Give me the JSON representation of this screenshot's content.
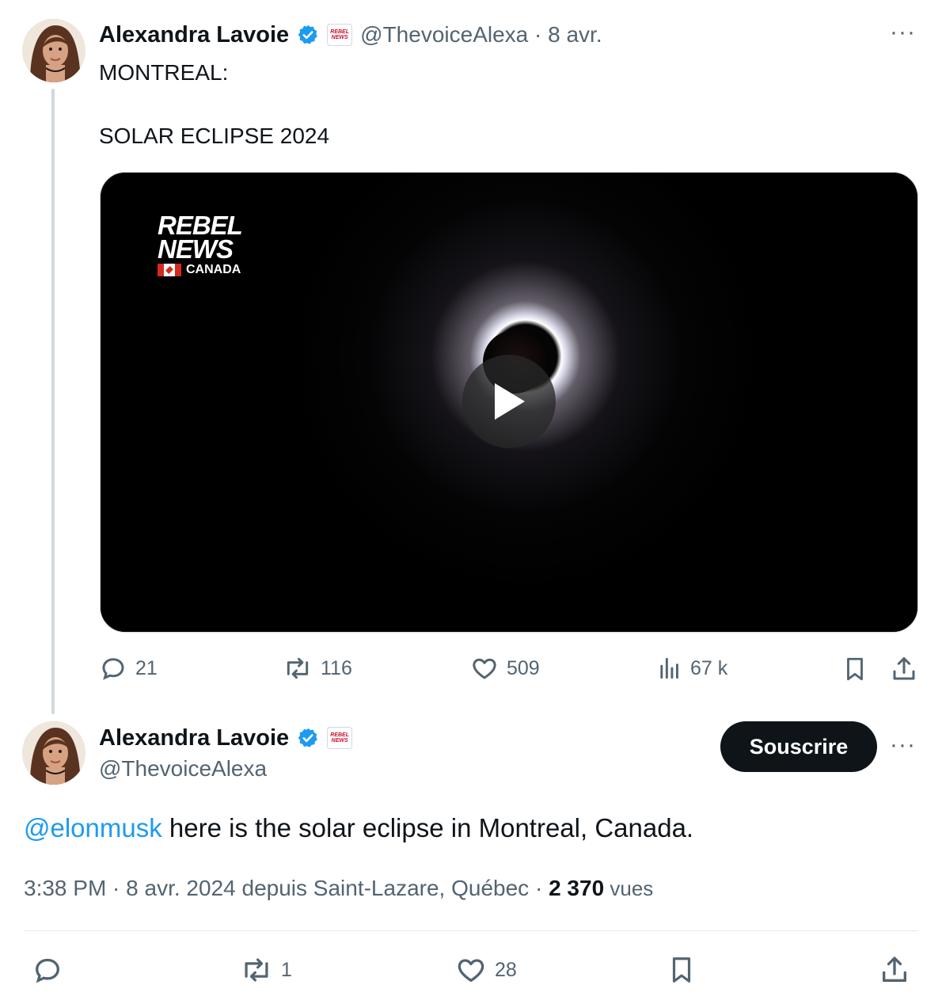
{
  "tweet1": {
    "author_name": "Alexandra Lavoie",
    "handle": "@ThevoiceAlexa",
    "date_sep": " · ",
    "date": "8 avr.",
    "more": "···",
    "text_line1": "MONTREAL:",
    "text_line2": "SOLAR ECLIPSE 2024",
    "media": {
      "logo_line1": "REBEL",
      "logo_line2": "NEWS",
      "logo_line3": "CANADA"
    },
    "actions": {
      "replies": "21",
      "reposts": "116",
      "likes": "509",
      "views": "67 k"
    }
  },
  "tweet2": {
    "author_name": "Alexandra Lavoie",
    "handle": "@ThevoiceAlexa",
    "subscribe_label": "Souscrire",
    "more": "···",
    "mention": "@elonmusk",
    "text": " here is the solar eclipse in Montreal, Canada.",
    "time": "3:38 PM",
    "sep1": " · ",
    "date": "8 avr. 2024 depuis Saint-Lazare, Québec",
    "sep2": " · ",
    "views_count": "2 370",
    "views_label": " vues",
    "actions": {
      "replies": "",
      "reposts": "1",
      "likes": "28"
    }
  },
  "affiliate_badge": "REBEL NEWS",
  "colors": {
    "link": "#1d9bf0",
    "verified": "#1d9bf0",
    "muted": "#536471",
    "text": "#0f1419"
  }
}
